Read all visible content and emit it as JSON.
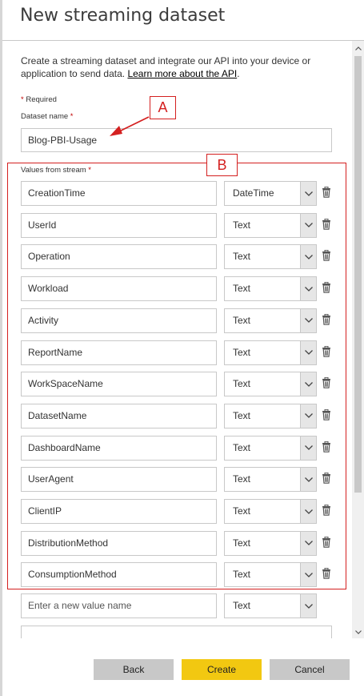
{
  "panel": {
    "title": "New streaming dataset",
    "description_prefix": "Create a streaming dataset and integrate our API into your device or application to send data. ",
    "description_link": "Learn more about the API",
    "description_suffix": ".",
    "required_star": "*",
    "required_label": "Required",
    "dataset_name_label": "Dataset name",
    "dataset_name_value": "Blog-PBI-Usage",
    "values_label": "Values from stream"
  },
  "fields": [
    {
      "name": "CreationTime",
      "type": "DateTime"
    },
    {
      "name": "UserId",
      "type": "Text"
    },
    {
      "name": "Operation",
      "type": "Text"
    },
    {
      "name": "Workload",
      "type": "Text"
    },
    {
      "name": "Activity",
      "type": "Text"
    },
    {
      "name": "ReportName",
      "type": "Text"
    },
    {
      "name": "WorkSpaceName",
      "type": "Text"
    },
    {
      "name": "DatasetName",
      "type": "Text"
    },
    {
      "name": "DashboardName",
      "type": "Text"
    },
    {
      "name": "UserAgent",
      "type": "Text"
    },
    {
      "name": "ClientIP",
      "type": "Text"
    },
    {
      "name": "DistributionMethod",
      "type": "Text"
    },
    {
      "name": "ConsumptionMethod",
      "type": "Text"
    }
  ],
  "new_field": {
    "placeholder": "Enter a new value name",
    "type": "Text"
  },
  "buttons": {
    "back": "Back",
    "create": "Create",
    "cancel": "Cancel"
  },
  "annotations": {
    "a": "A",
    "b": "B"
  },
  "colors": {
    "accent_yellow": "#f2c811",
    "annotation_red": "#d42020",
    "button_gray": "#c8c8c8"
  },
  "icons": {
    "trash": "trash-icon",
    "dropdown": "chevron-down-icon"
  }
}
